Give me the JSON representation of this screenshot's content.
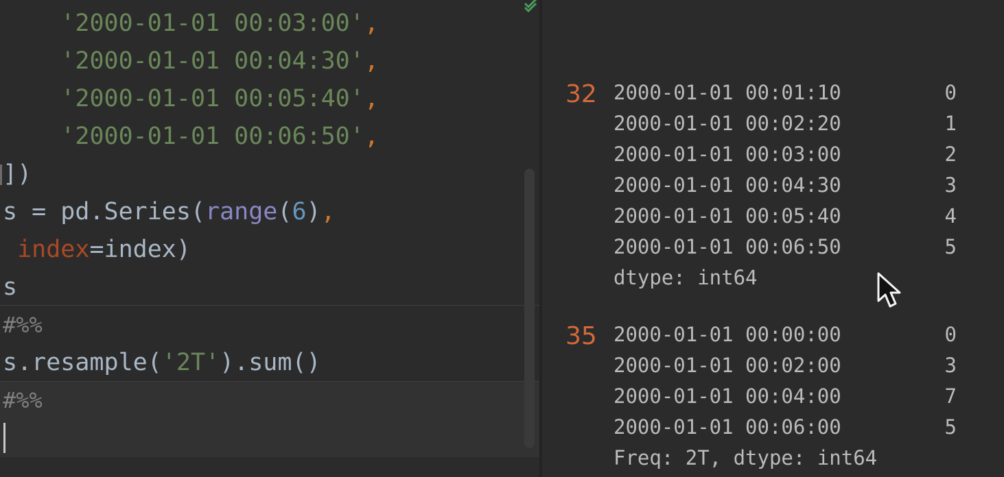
{
  "editor": {
    "lines": [
      {
        "indent": "    ",
        "string": "'2000-01-01 00:03:00'",
        "comma": ","
      },
      {
        "indent": "    ",
        "string": "'2000-01-01 00:04:30'",
        "comma": ","
      },
      {
        "indent": "    ",
        "string": "'2000-01-01 00:05:40'",
        "comma": ","
      },
      {
        "indent": "    ",
        "string": "'2000-01-01 00:06:50'",
        "comma": ","
      }
    ],
    "close_bracket": "])",
    "series_line": {
      "s": "s = pd.Series(",
      "builtin": "range",
      "paren_open": "(",
      "number": "6",
      "paren_close": ")",
      "comma": ","
    },
    "index_line": {
      "indent": " ",
      "kwarg": "index",
      "rest": "=index)"
    },
    "s_line": "s",
    "cell_marker_1": "#%%",
    "resample_line": {
      "pre": "s.resample(",
      "string": "'2T'",
      "post": ").sum()"
    },
    "cell_marker_2": "#%%"
  },
  "output": {
    "block1": {
      "prompt": "32",
      "rows": [
        {
          "ts": "2000-01-01 00:01:10",
          "val": "0"
        },
        {
          "ts": "2000-01-01 00:02:20",
          "val": "1"
        },
        {
          "ts": "2000-01-01 00:03:00",
          "val": "2"
        },
        {
          "ts": "2000-01-01 00:04:30",
          "val": "3"
        },
        {
          "ts": "2000-01-01 00:05:40",
          "val": "4"
        },
        {
          "ts": "2000-01-01 00:06:50",
          "val": "5"
        }
      ],
      "footer": "dtype: int64"
    },
    "block2": {
      "prompt": "35",
      "rows": [
        {
          "ts": "2000-01-01 00:00:00",
          "val": "0"
        },
        {
          "ts": "2000-01-01 00:02:00",
          "val": "3"
        },
        {
          "ts": "2000-01-01 00:04:00",
          "val": "7"
        },
        {
          "ts": "2000-01-01 00:06:00",
          "val": "5"
        }
      ],
      "footer": "Freq: 2T, dtype: int64"
    }
  },
  "icons": {
    "inspection": "check-icon",
    "cursor": "mouse-pointer-icon"
  },
  "colors": {
    "background": "#2b2b2b",
    "string": "#6a8759",
    "punctuation": "#cc7832",
    "prompt": "#d4693a",
    "output_text": "#bbbbbb"
  }
}
